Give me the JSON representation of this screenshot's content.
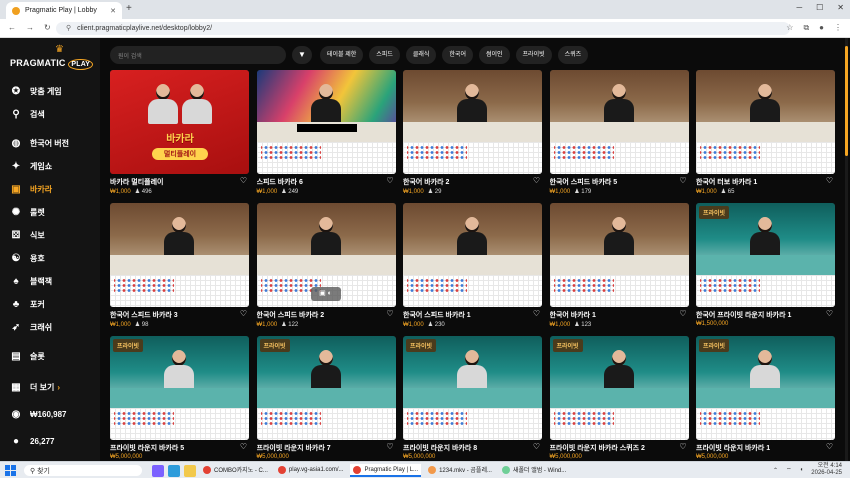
{
  "browser": {
    "tab_title": "Pragmatic Play | Lobby",
    "url": "client.pragmaticplaylive.net/desktop/lobby2/"
  },
  "brand": {
    "name": "PRAGMATIC",
    "suffix": "PLAY"
  },
  "sidebar": {
    "items": [
      {
        "label": "맞춤 게임",
        "icon": "star-icon",
        "active": false
      },
      {
        "label": "검색",
        "icon": "search-icon",
        "active": false
      },
      {
        "label": "한국어 버전",
        "icon": "globe-icon",
        "active": false
      },
      {
        "label": "게임쇼",
        "icon": "gameshow-icon",
        "active": false
      },
      {
        "label": "바카라",
        "icon": "baccarat-icon",
        "active": true
      },
      {
        "label": "룰렛",
        "icon": "roulette-icon",
        "active": false
      },
      {
        "label": "식보",
        "icon": "dice-icon",
        "active": false
      },
      {
        "label": "용호",
        "icon": "dragon-tiger-icon",
        "active": false
      },
      {
        "label": "블랙잭",
        "icon": "blackjack-icon",
        "active": false
      },
      {
        "label": "포커",
        "icon": "poker-icon",
        "active": false
      },
      {
        "label": "크래쉬",
        "icon": "rocket-icon",
        "active": false
      },
      {
        "label": "슬롯",
        "icon": "slot-icon",
        "active": false
      }
    ],
    "more_label": "더 보기",
    "balance": "₩160,987",
    "players": "26,277"
  },
  "filters": {
    "search_placeholder": "원이 검색",
    "chips": [
      "테이블 제한",
      "스피드",
      "클래식",
      "한국어",
      "썸이인",
      "프라이빗",
      "스퀴즈"
    ]
  },
  "cards": [
    {
      "title": "바카라 멀티플레이",
      "limit": "₩1,000",
      "players": "496",
      "scene": "red",
      "badge": "",
      "promo": "바카라",
      "promo_sub": "멀티플레이"
    },
    {
      "title": "스피드 바카라 6",
      "limit": "₩1,000",
      "players": "249",
      "scene": "art",
      "badge": "",
      "promo": "",
      "promo_sub": ""
    },
    {
      "title": "한국어 바카라 2",
      "limit": "₩1,000",
      "players": "29",
      "scene": "wood",
      "badge": "",
      "promo": "",
      "promo_sub": ""
    },
    {
      "title": "한국어 스피드 바카라 5",
      "limit": "₩1,000",
      "players": "179",
      "scene": "wood",
      "badge": "",
      "promo": "",
      "promo_sub": ""
    },
    {
      "title": "한국어 터보 바카라 1",
      "limit": "₩1,000",
      "players": "65",
      "scene": "wood",
      "badge": "",
      "promo": "",
      "promo_sub": ""
    },
    {
      "title": "한국어 스피드 바카라 3",
      "limit": "₩1,000",
      "players": "98",
      "scene": "wood",
      "badge": "",
      "promo": "",
      "promo_sub": ""
    },
    {
      "title": "한국어 스피드 바카라 2",
      "limit": "₩1,000",
      "players": "122",
      "scene": "wood",
      "badge": "",
      "promo": "",
      "promo_sub": ""
    },
    {
      "title": "한국어 스피드 바카라 1",
      "limit": "₩1,000",
      "players": "230",
      "scene": "wood",
      "badge": "",
      "promo": "",
      "promo_sub": ""
    },
    {
      "title": "한국어 바카라 1",
      "limit": "₩1,000",
      "players": "123",
      "scene": "wood",
      "badge": "",
      "promo": "",
      "promo_sub": ""
    },
    {
      "title": "한국어 프라이빗 라운지 바카라 1",
      "limit": "₩1,500,000",
      "players": "",
      "scene": "teal",
      "badge": "프라이빗",
      "promo": "",
      "promo_sub": ""
    },
    {
      "title": "프라이빗 라운지 바카라 5",
      "limit": "₩5,000,000",
      "players": "",
      "scene": "teal",
      "badge": "프라이빗",
      "promo": "",
      "promo_sub": ""
    },
    {
      "title": "프라이빗 라운지 바카라 7",
      "limit": "₩5,000,000",
      "players": "",
      "scene": "teal",
      "badge": "프라이빗",
      "promo": "",
      "promo_sub": ""
    },
    {
      "title": "프라이빗 라운지 바카라 8",
      "limit": "₩5,000,000",
      "players": "",
      "scene": "teal",
      "badge": "프라이빗",
      "promo": "",
      "promo_sub": ""
    },
    {
      "title": "프라이빗 라운지 바카라 스퀴즈 2",
      "limit": "₩5,000,000",
      "players": "",
      "scene": "teal",
      "badge": "프라이빗",
      "promo": "",
      "promo_sub": ""
    },
    {
      "title": "프라이빗 라운지 바카라 1",
      "limit": "₩5,000,000",
      "players": "",
      "scene": "teal",
      "badge": "프라이빗",
      "promo": "",
      "promo_sub": ""
    }
  ],
  "taskbar": {
    "search_label": "찾기",
    "apps": [
      "COMBO카지노 - C...",
      "play.vg-asia1.com/...",
      "Pragmatic Play | L...",
      "1234.mkv - 곰플레...",
      "새폴더 앨범 - Wind..."
    ],
    "time": "오전 4:14",
    "date": "2026-04-25"
  }
}
